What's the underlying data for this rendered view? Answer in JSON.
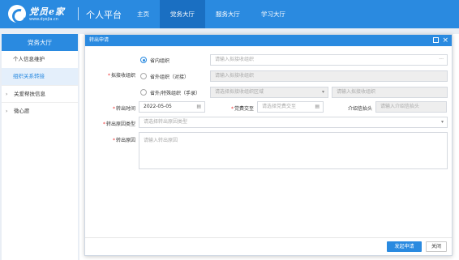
{
  "brand": {
    "name": "党员e家",
    "url": "www.dyejia.cn"
  },
  "platform": "个人平台",
  "nav": [
    "主页",
    "党务大厅",
    "服务大厅",
    "学习大厅"
  ],
  "sidebar": {
    "title": "党务大厅",
    "items": [
      "个人信息维护",
      "组织关系转接",
      "关爱帮扶信息",
      "微心愿"
    ]
  },
  "dialog": {
    "title": "转出申请",
    "receive_org_label": "拟接收组织",
    "options": [
      "省内组织",
      "省外组织（对接）",
      "省外/特殊组织（手录）"
    ],
    "opt1_placeholder": "请输入拟接收组织",
    "opt2_placeholder": "请输入拟接收组织",
    "opt3_region_placeholder": "请选择拟接收组织区域",
    "opt3_org_placeholder": "请输入拟接收组织",
    "date_label": "转出时间",
    "date_value": "2022-05-05",
    "fee_label": "党费交至",
    "fee_placeholder": "请选择党费交至",
    "intro_label": "介绍信抬头",
    "intro_placeholder": "请输入介绍信抬头",
    "type_label": "转出原因类型",
    "type_placeholder": "请选择转出原因类型",
    "reason_label": "转出原因",
    "reason_placeholder": "请输入转出原因",
    "submit": "发起申请",
    "close": "关闭"
  },
  "colors": {
    "primary": "#2a8ae0",
    "nav_active": "#1a6fc2",
    "required": "#e33333"
  }
}
